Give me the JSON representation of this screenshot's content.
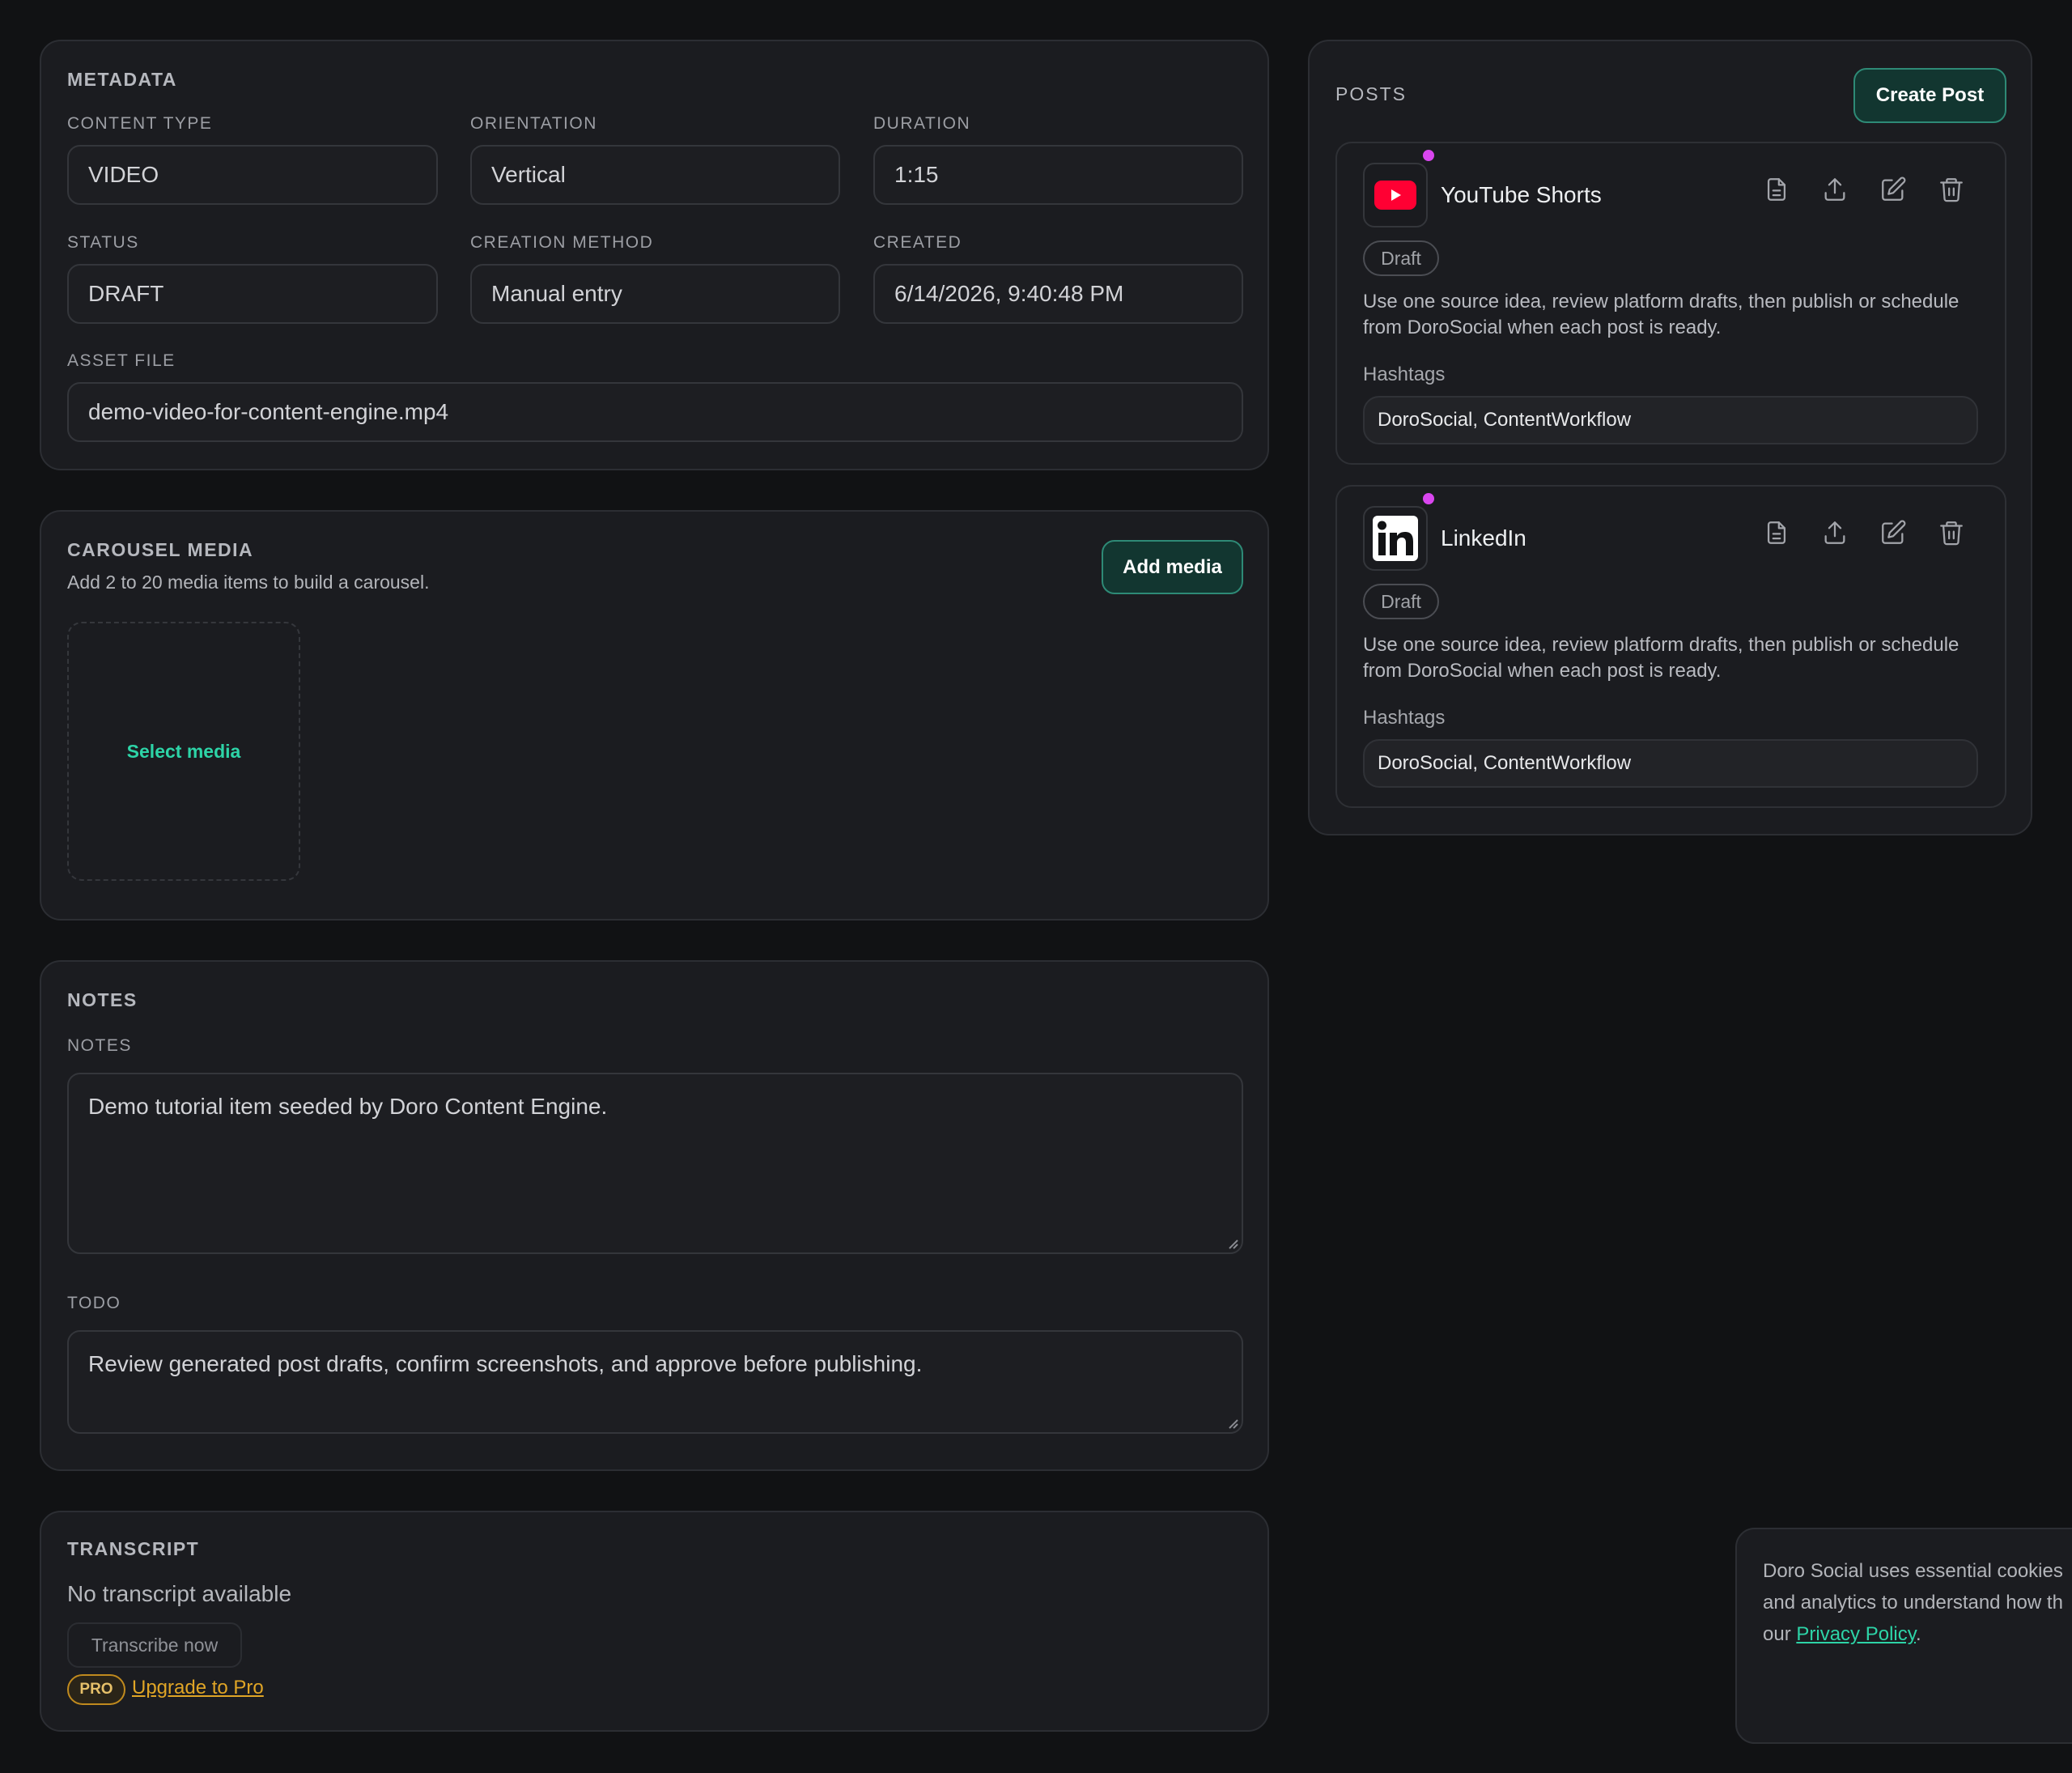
{
  "metadata": {
    "title": "METADATA",
    "content_type": {
      "label": "CONTENT TYPE",
      "value": "VIDEO"
    },
    "orientation": {
      "label": "ORIENTATION",
      "value": "Vertical"
    },
    "duration": {
      "label": "DURATION",
      "value": "1:15"
    },
    "status": {
      "label": "STATUS",
      "value": "DRAFT"
    },
    "creation_method": {
      "label": "CREATION METHOD",
      "value": "Manual entry"
    },
    "created": {
      "label": "CREATED",
      "value": "6/14/2026, 9:40:48 PM"
    },
    "asset_file": {
      "label": "ASSET FILE",
      "value": "demo-video-for-content-engine.mp4"
    }
  },
  "carousel": {
    "title": "CAROUSEL MEDIA",
    "subtitle": "Add 2 to 20 media items to build a carousel.",
    "add_button": "Add media",
    "select_media": "Select media"
  },
  "notes": {
    "title": "NOTES",
    "notes_label": "NOTES",
    "notes_value": "Demo tutorial item seeded by Doro Content Engine.",
    "todo_label": "TODO",
    "todo_value": "Review generated post drafts, confirm screenshots, and approve before publishing."
  },
  "transcript": {
    "title": "TRANSCRIPT",
    "empty_text": "No transcript available",
    "transcribe_button": "Transcribe now",
    "pro_badge": "PRO",
    "upgrade_link": "Upgrade to Pro"
  },
  "posts": {
    "title": "POSTS",
    "create_button": "Create Post",
    "items": [
      {
        "platform": "YouTube Shorts",
        "icon": "youtube-logo-icon",
        "status": "Draft",
        "description": "Use one source idea, review platform drafts, then publish or schedule from DoroSocial when each post is ready.",
        "hashtags_label": "Hashtags",
        "hashtags": "DoroSocial, ContentWorkflow"
      },
      {
        "platform": "LinkedIn",
        "icon": "linkedin-logo-icon",
        "status": "Draft",
        "description": "Use one source idea, review platform drafts, then publish or schedule from DoroSocial when each post is ready.",
        "hashtags_label": "Hashtags",
        "hashtags": "DoroSocial, ContentWorkflow"
      }
    ]
  },
  "cookie": {
    "line1": "Doro Social uses essential cookies",
    "line2": "and analytics to understand how th",
    "line3_prefix": "our ",
    "policy_link": "Privacy Policy",
    "line3_suffix": "."
  },
  "colors": {
    "background": "#111214",
    "card": "#1b1c20",
    "accent_green": "#2dd4a7",
    "status_dot": "#d946ef",
    "youtube_red": "#ff0033",
    "pro_gold": "#e0a526"
  }
}
